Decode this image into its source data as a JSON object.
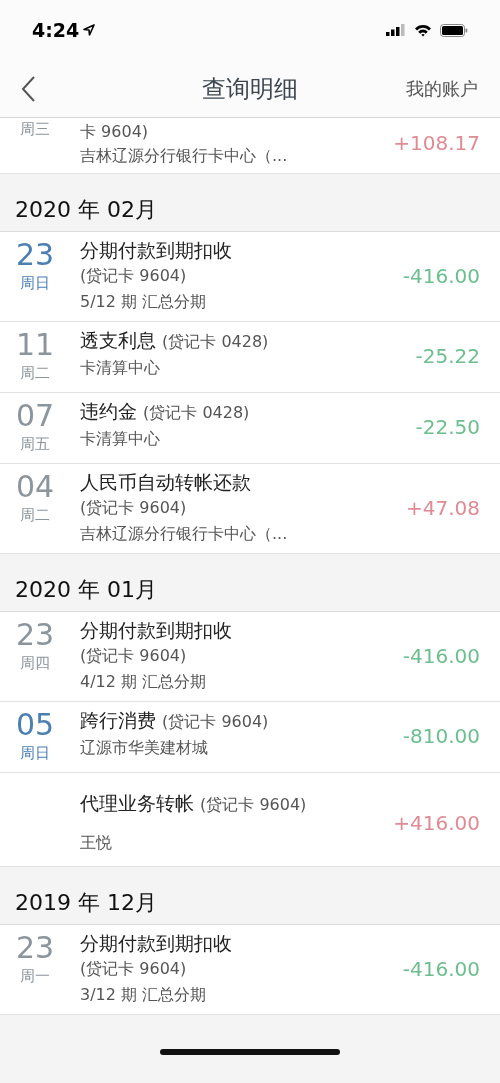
{
  "status_bar": {
    "time": "4:24"
  },
  "nav": {
    "title": "查询明细",
    "right_link": "我的账户"
  },
  "groups": [
    {
      "entries": [
        {
          "weekday": "周三",
          "card": "卡 9604)",
          "details": [
            "吉林辽源分行银行卡中心（..."
          ],
          "amount": "+108.17",
          "kind": "credit"
        }
      ]
    },
    {
      "month": "2020 年 02月",
      "entries": [
        {
          "day": "23",
          "weekday": "周日",
          "color": "#4a7fb3",
          "title": "分期付款到期扣收",
          "card": "(贷记卡 9604)",
          "details": [
            "5/12 期 汇总分期"
          ],
          "amount": "-416.00",
          "kind": "debit"
        },
        {
          "day": "11",
          "weekday": "周二",
          "color": "#8c949c",
          "title": "透支利息",
          "card": "(贷记卡 0428)",
          "details": [
            "卡清算中心"
          ],
          "amount": "-25.22",
          "kind": "debit"
        },
        {
          "day": "07",
          "weekday": "周五",
          "color": "#8c949c",
          "title": "违约金",
          "card": "(贷记卡 0428)",
          "details": [
            "卡清算中心"
          ],
          "amount": "-22.50",
          "kind": "debit"
        },
        {
          "day": "04",
          "weekday": "周二",
          "color": "#8c949c",
          "title": "人民币自动转帐还款",
          "card": "(贷记卡 9604)",
          "details": [
            "吉林辽源分行银行卡中心（..."
          ],
          "amount": "+47.08",
          "kind": "credit"
        }
      ]
    },
    {
      "month": "2020 年 01月",
      "entries": [
        {
          "day": "23",
          "weekday": "周四",
          "color": "#8c949c",
          "title": "分期付款到期扣收",
          "card": "(贷记卡 9604)",
          "details": [
            "4/12 期 汇总分期"
          ],
          "amount": "-416.00",
          "kind": "debit"
        },
        {
          "day": "05",
          "weekday": "周日",
          "color": "#4a7fb3",
          "title": "跨行消费",
          "card": "(贷记卡 9604)",
          "details": [
            "辽源市华美建材城"
          ],
          "amount": "-810.00",
          "kind": "debit"
        },
        {
          "title": "代理业务转帐",
          "card": "(贷记卡 9604)",
          "details": [
            "王悦"
          ],
          "amount": "+416.00",
          "kind": "credit"
        }
      ]
    },
    {
      "month": "2019 年 12月",
      "entries": [
        {
          "day": "23",
          "weekday": "周一",
          "color": "#8c949c",
          "title": "分期付款到期扣收",
          "card": "(贷记卡 9604)",
          "details": [
            "3/12 期 汇总分期"
          ],
          "amount": "-416.00",
          "kind": "debit"
        }
      ]
    }
  ]
}
